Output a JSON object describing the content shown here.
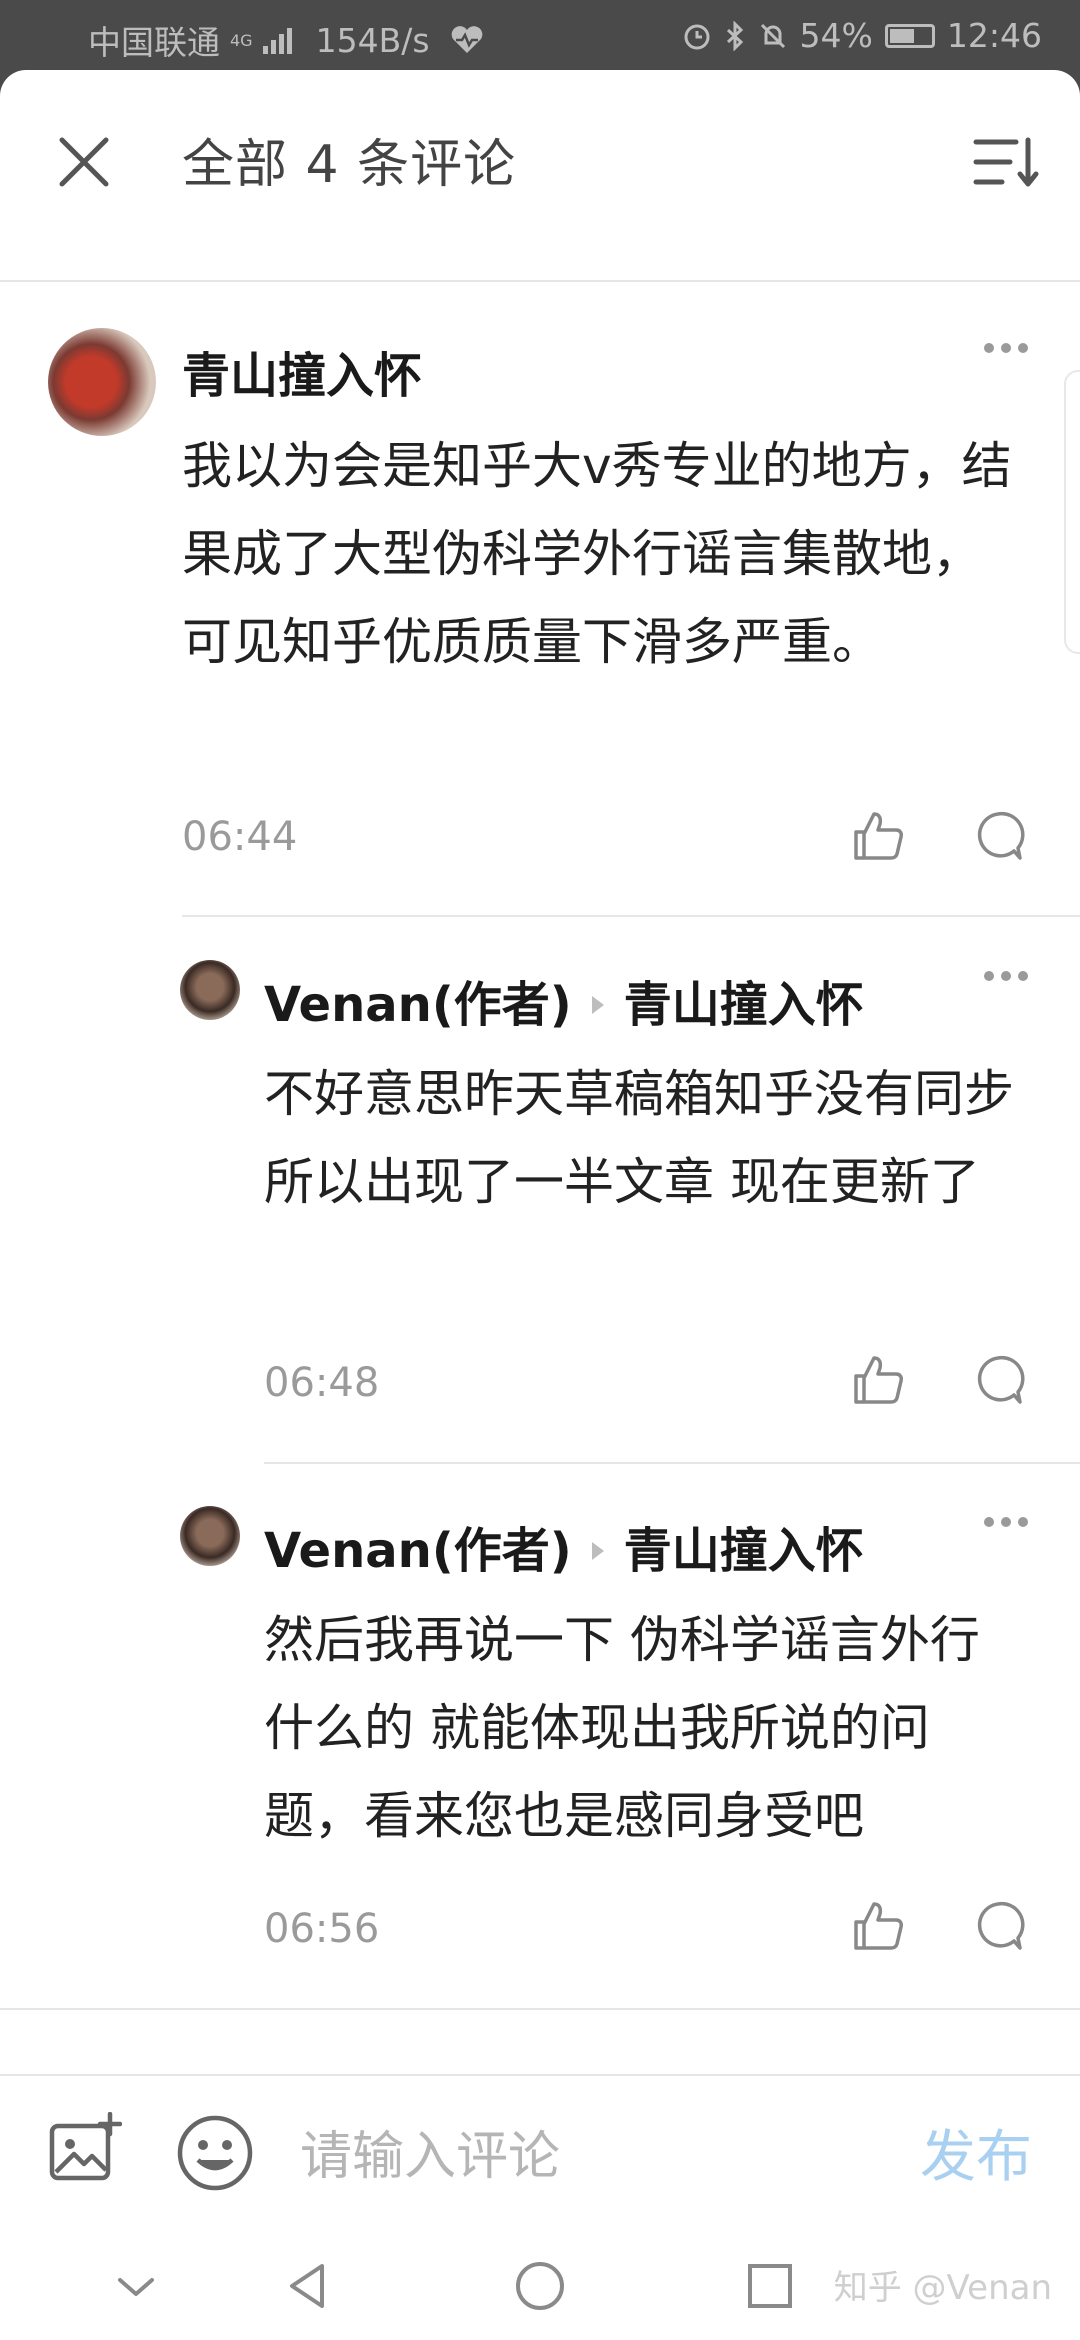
{
  "status_bar": {
    "carrier": "中国联通",
    "network": "4G",
    "speed": "154B/s",
    "battery": "54%",
    "time": "12:46"
  },
  "header": {
    "title": "全部 4 条评论",
    "close_icon": "close-icon",
    "sort_icon": "sort-icon"
  },
  "comments": [
    {
      "author": "青山撞入怀",
      "reply_to": "",
      "body": "我以为会是知乎大v秀专业的地方，结果成了大型伪科学外行谣言集散地，可见知乎优质质量下滑多严重。",
      "time": "06:44"
    },
    {
      "author": "Venan(作者)",
      "reply_to": "青山撞入怀",
      "body": "不好意思昨天草稿箱知乎没有同步所以出现了一半文章 现在更新了",
      "time": "06:48"
    },
    {
      "author": "Venan(作者)",
      "reply_to": "青山撞入怀",
      "body": "然后我再说一下 伪科学谣言外行什么的 就能体现出我所说的问题，看来您也是感同身受吧",
      "time": "06:56"
    }
  ],
  "input_bar": {
    "placeholder": "请输入评论",
    "publish_label": "发布"
  },
  "nav": {
    "watermark": "知乎 @Venan"
  }
}
